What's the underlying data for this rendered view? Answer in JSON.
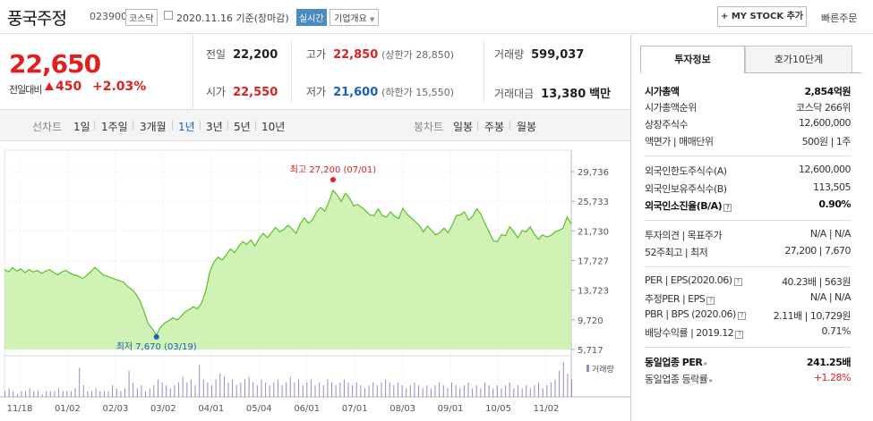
{
  "header": {
    "stock_name": "풍국주정",
    "code": "023900",
    "market": "코스닥",
    "date_basis": "2020.11.16 기준(장마감)",
    "live_badge": "실시간",
    "company_info": "기업개요",
    "my_stock_button": "+ MY STOCK 추가",
    "quick_order": "빠른주문"
  },
  "price": {
    "current": "22,650",
    "change_label": "전일대비",
    "change": "450",
    "change_rate": "+2.03%",
    "up_color": "#e02020"
  },
  "quotes": {
    "prev_close_label": "전일",
    "prev_close": "22,200",
    "high_label": "고가",
    "high": "22,850",
    "upper_limit": "(상한가 28,850)",
    "volume_label": "거래량",
    "volume": "599,037",
    "open_label": "시가",
    "open": "22,550",
    "low_label": "저가",
    "low": "21,600",
    "lower_limit": "(하한가 15,550)",
    "amount_label": "거래대금",
    "amount": "13,380",
    "amount_unit": "백만"
  },
  "period_tabs": {
    "line_label": "선차트",
    "line_items": [
      "1일",
      "1주일",
      "3개월",
      "1년",
      "3년",
      "5년",
      "10년"
    ],
    "selected": "1년",
    "candle_label": "봉차트",
    "candle_items": [
      "일봉",
      "주봉",
      "월봉"
    ]
  },
  "chart_data": {
    "type": "area",
    "yticks": [
      "29,736",
      "25,733",
      "21,730",
      "17,727",
      "13,723",
      "9,720",
      "5,717"
    ],
    "ylim": [
      5717,
      29736
    ],
    "xticks": [
      "11/18",
      "01/02",
      "02/03",
      "03/02",
      "04/01",
      "05/04",
      "06/01",
      "07/01",
      "08/03",
      "09/01",
      "10/05",
      "11/02"
    ],
    "high_annotation": "최고 27,200 (07/01)",
    "low_annotation": "최저 7,670 (03/19)",
    "volume_legend": "거래량",
    "fill_color": "#c8f0a8",
    "line_color": "#5cbf2a",
    "series": [
      {
        "values": [
          16500,
          16200,
          16800,
          16300,
          16600,
          16100,
          16500,
          16200,
          16400,
          16000,
          16300,
          16500,
          16100,
          15800,
          16200,
          16400,
          16000,
          15800,
          15600,
          15300,
          15700,
          16200,
          16800,
          16300,
          15800,
          15600,
          15400,
          15200,
          15000,
          14800,
          14200,
          13800,
          13200,
          12300,
          10800,
          9200,
          8500,
          7670,
          8700,
          9300,
          9600,
          10000,
          9700,
          10200,
          10800,
          11100,
          11500,
          11200,
          12000,
          13600,
          16200,
          17500,
          18200,
          17800,
          18500,
          19300,
          18800,
          19600,
          20300,
          19900,
          20500,
          19700,
          20700,
          21400,
          20800,
          21500,
          22200,
          21600,
          21900,
          22500,
          22000,
          21400,
          22700,
          23500,
          22800,
          23200,
          24300,
          24900,
          24400,
          25700,
          27200,
          26600,
          25700,
          26800,
          26200,
          25100,
          25300,
          24900,
          24400,
          23900,
          23800,
          24700,
          23800,
          23600,
          24300,
          23700,
          23400,
          24800,
          24000,
          23500,
          23000,
          22500,
          21600,
          22400,
          21800,
          21200,
          21500,
          22100,
          21500,
          22500,
          23800,
          23900,
          24300,
          23200,
          23700,
          24700,
          24000,
          22700,
          21600,
          20400,
          20300,
          21200,
          21100,
          22300,
          21600,
          20800,
          21800,
          21600,
          22300,
          21300,
          20600,
          21200,
          20900,
          21100,
          21600,
          21800,
          22100,
          23600,
          22650
        ]
      }
    ],
    "volume": [
      2,
      3,
      2,
      1,
      2,
      2,
      3,
      2,
      2,
      1,
      2,
      2,
      2,
      3,
      2,
      2,
      2,
      3,
      10,
      4,
      2,
      2,
      3,
      2,
      2,
      2,
      4,
      3,
      2,
      3,
      9,
      5,
      3,
      4,
      2,
      3,
      4,
      6,
      5,
      4,
      3,
      4,
      5,
      7,
      5,
      6,
      4,
      11,
      6,
      5,
      4,
      6,
      8,
      7,
      5,
      6,
      4,
      5,
      6,
      7,
      5,
      4,
      6,
      5,
      4,
      5,
      6,
      4,
      5,
      7,
      5,
      6,
      4,
      5,
      6,
      4,
      5,
      4,
      6,
      5,
      4,
      5,
      6,
      5,
      4,
      5,
      4,
      3,
      4,
      5,
      4,
      5,
      6,
      5,
      4,
      5,
      4,
      3,
      4,
      5,
      4,
      3,
      4,
      3,
      4,
      5,
      4,
      3,
      5,
      4,
      3,
      4,
      5,
      3,
      4,
      3,
      5,
      4,
      3,
      4,
      3,
      4,
      5,
      3,
      4,
      3,
      4,
      3,
      4,
      5,
      3,
      4,
      5,
      6,
      9,
      12,
      8,
      6
    ]
  },
  "invest": {
    "tab_active": "투자정보",
    "tab_other": "호가10단계",
    "market_cap_label": "시가총액",
    "market_cap": "2,854억원",
    "rank_label": "시가총액순위",
    "rank": "코스닥 266위",
    "shares_label": "상장주식수",
    "shares": "12,600,000",
    "par_label": "액면가 | 매매단위",
    "par": "500원 | 1주",
    "foreign_limit_label": "외국인한도주식수(A)",
    "foreign_limit": "12,600,000",
    "foreign_hold_label": "외국인보유주식수(B)",
    "foreign_hold": "113,505",
    "foreign_ratio_label": "외국인소진율(B/A)",
    "foreign_ratio": "0.90%",
    "opinion_label": "투자의견 | 목표주가",
    "opinion": "N/A | N/A",
    "week52_label": "52주최고 | 최저",
    "week52": "27,200 | 7,670",
    "per_label": "PER | EPS(2020.06)",
    "per": "40.23배 | 563원",
    "est_per_label": "추정PER | EPS",
    "est_per": "N/A | N/A",
    "pbr_label": "PBR | BPS (2020.06)",
    "pbr": "2.11배 | 10,729원",
    "dividend_label": "배당수익률 | 2019.12",
    "dividend": "0.71%",
    "industry_per_label": "동일업종 PER",
    "industry_per": "241.25배",
    "industry_rate_label": "동일업종 등락률",
    "industry_rate": "+1.28%"
  }
}
